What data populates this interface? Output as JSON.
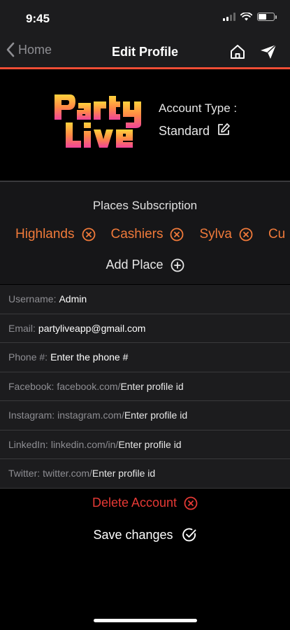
{
  "status": {
    "time": "9:45"
  },
  "nav": {
    "back_label": "Home",
    "title": "Edit Profile"
  },
  "profile": {
    "logo_text": "PartyLive",
    "account_type_label": "Account Type :",
    "account_type_value": "Standard"
  },
  "places": {
    "title": "Places Subscription",
    "items": [
      {
        "label": "Highlands"
      },
      {
        "label": "Cashiers"
      },
      {
        "label": "Sylva"
      },
      {
        "label": "Cu"
      }
    ],
    "add_label": "Add Place"
  },
  "fields": {
    "username": {
      "label": "Username:",
      "value": "Admin"
    },
    "email": {
      "label": "Email:",
      "value": "partyliveapp@gmail.com"
    },
    "phone": {
      "label": "Phone #:",
      "placeholder": "Enter the phone #"
    },
    "facebook": {
      "label": "Facebook:",
      "prefix": "facebook.com/",
      "placeholder": "Enter profile id"
    },
    "instagram": {
      "label": "Instagram:",
      "prefix": "instagram.com/",
      "placeholder": "Enter profile id"
    },
    "linkedin": {
      "label": "LinkedIn:",
      "prefix": "linkedin.com/in/",
      "placeholder": "Enter profile id"
    },
    "twitter": {
      "label": "Twitter:",
      "prefix": "twitter.com/",
      "placeholder": "Enter profile id"
    }
  },
  "actions": {
    "delete_label": "Delete Account",
    "save_label": "Save changes"
  },
  "colors": {
    "accent": "#ef4d35",
    "chip": "#f07a3a",
    "danger": "#e53935"
  }
}
